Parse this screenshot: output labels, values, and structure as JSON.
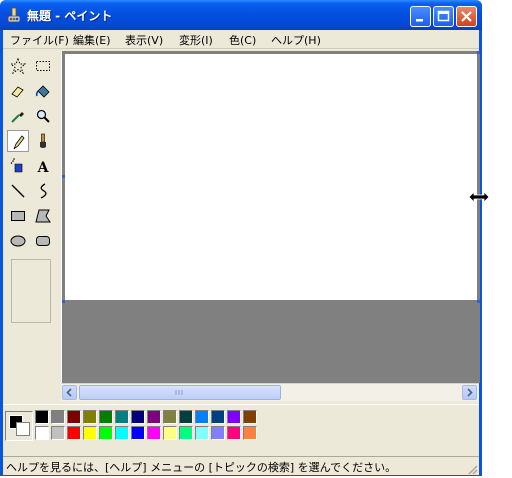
{
  "window": {
    "title": "無題 - ペイント"
  },
  "menu": [
    "ファイル(F)",
    "編集(E)",
    "表示(V)",
    "変形(I)",
    "色(C)",
    "ヘルプ(H)"
  ],
  "tools": [
    {
      "name": "free-form-select-tool",
      "icon": "star-select-icon"
    },
    {
      "name": "rect-select-tool",
      "icon": "dashed-rect-icon"
    },
    {
      "name": "eraser-tool",
      "icon": "eraser-icon"
    },
    {
      "name": "fill-tool",
      "icon": "paint-bucket-icon"
    },
    {
      "name": "pick-color-tool",
      "icon": "eyedropper-icon"
    },
    {
      "name": "magnifier-tool",
      "icon": "magnifier-icon"
    },
    {
      "name": "pencil-tool",
      "icon": "pencil-icon",
      "active": true
    },
    {
      "name": "brush-tool",
      "icon": "brush-icon"
    },
    {
      "name": "airbrush-tool",
      "icon": "airbrush-icon"
    },
    {
      "name": "text-tool",
      "icon": "text-a-icon",
      "glyph": "A"
    },
    {
      "name": "line-tool",
      "icon": "line-icon"
    },
    {
      "name": "curve-tool",
      "icon": "curve-icon"
    },
    {
      "name": "rectangle-tool",
      "icon": "rectangle-icon"
    },
    {
      "name": "polygon-tool",
      "icon": "polygon-icon"
    },
    {
      "name": "ellipse-tool",
      "icon": "ellipse-icon"
    },
    {
      "name": "rounded-rect-tool",
      "icon": "rounded-rect-icon"
    }
  ],
  "palette": {
    "foreground": "#000000",
    "background": "#ffffff",
    "top_row": [
      "#000000",
      "#808080",
      "#800000",
      "#808000",
      "#008000",
      "#008080",
      "#000080",
      "#800080",
      "#808040",
      "#004040",
      "#0080ff",
      "#004080",
      "#8000ff",
      "#804000"
    ],
    "bottom_row": [
      "#ffffff",
      "#c0c0c0",
      "#ff0000",
      "#ffff00",
      "#00ff00",
      "#00ffff",
      "#0000ff",
      "#ff00ff",
      "#ffff80",
      "#00ff80",
      "#80ffff",
      "#8080ff",
      "#ff0080",
      "#ff8040"
    ]
  },
  "status": {
    "text": "ヘルプを見るには、[ヘルプ] メニューの [トピックの検索] を選んでください。"
  }
}
